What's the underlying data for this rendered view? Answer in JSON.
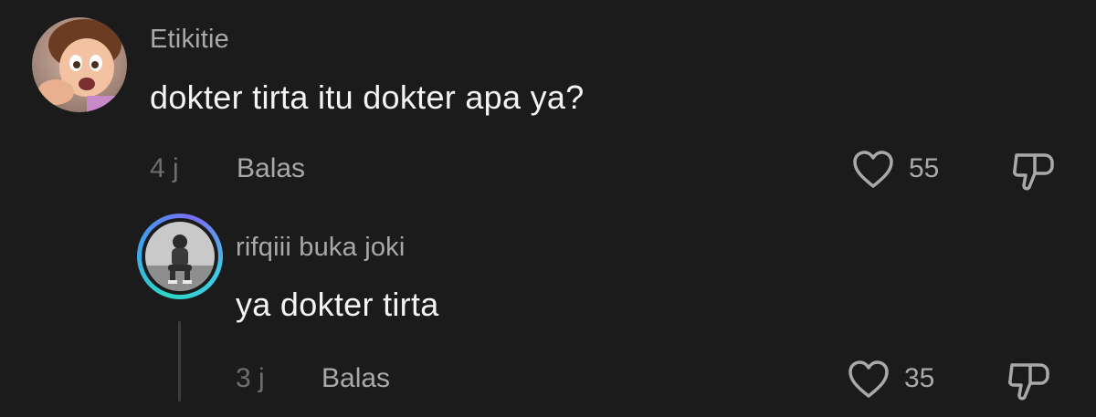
{
  "comment": {
    "username": "Etikitie",
    "text": "dokter tirta itu dokter apa ya?",
    "time": "4 j",
    "reply_label": "Balas",
    "likes": "55",
    "avatar": "cartoon-girl-avatar",
    "icons": {
      "like": "heart-icon",
      "dislike": "thumbs-down-icon"
    }
  },
  "reply": {
    "username": "rifqiii buka joki",
    "text": "ya dokter tirta",
    "time": "3 j",
    "reply_label": "Balas",
    "likes": "35",
    "avatar": "person-sitting-avatar",
    "icons": {
      "like": "heart-icon",
      "dislike": "thumbs-down-icon"
    }
  },
  "colors": {
    "background": "#1b1b1b",
    "text_primary": "#f4f4f4",
    "text_secondary": "#a9a9a9",
    "text_muted": "#6e6e6e",
    "story_ring": [
      "#2fd6c4",
      "#3fa0f0",
      "#7b6cf2"
    ]
  }
}
